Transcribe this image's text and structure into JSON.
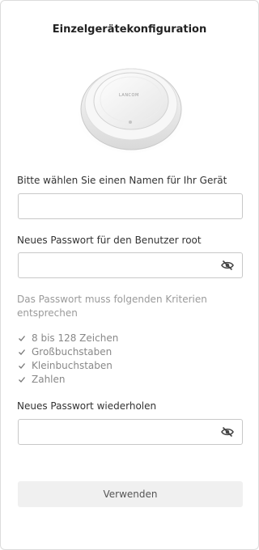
{
  "title": "Einzelgerätekonfiguration",
  "device": {
    "image_icon": "access-point-image",
    "brand_text": "LANCOM"
  },
  "name_field": {
    "label": "Bitte wählen Sie einen Namen für Ihr Gerät",
    "value": "",
    "placeholder": ""
  },
  "password_field": {
    "label": "Neues Passwort für den Benutzer root",
    "value": "",
    "placeholder": "",
    "toggle_icon": "eye-slash-icon"
  },
  "password_hint": "Das Passwort muss folgenden Kriterien entsprechen",
  "criteria": [
    "8 bis 128 Zeichen",
    "Großbuchstaben",
    "Kleinbuchstaben",
    "Zahlen"
  ],
  "repeat_field": {
    "label": "Neues Passwort wiederholen",
    "value": "",
    "placeholder": "",
    "toggle_icon": "eye-slash-icon"
  },
  "submit_label": "Verwenden",
  "colors": {
    "border": "#c8c8c8",
    "button_bg": "#f0f0f0",
    "hint_text": "#9a9a9a"
  }
}
